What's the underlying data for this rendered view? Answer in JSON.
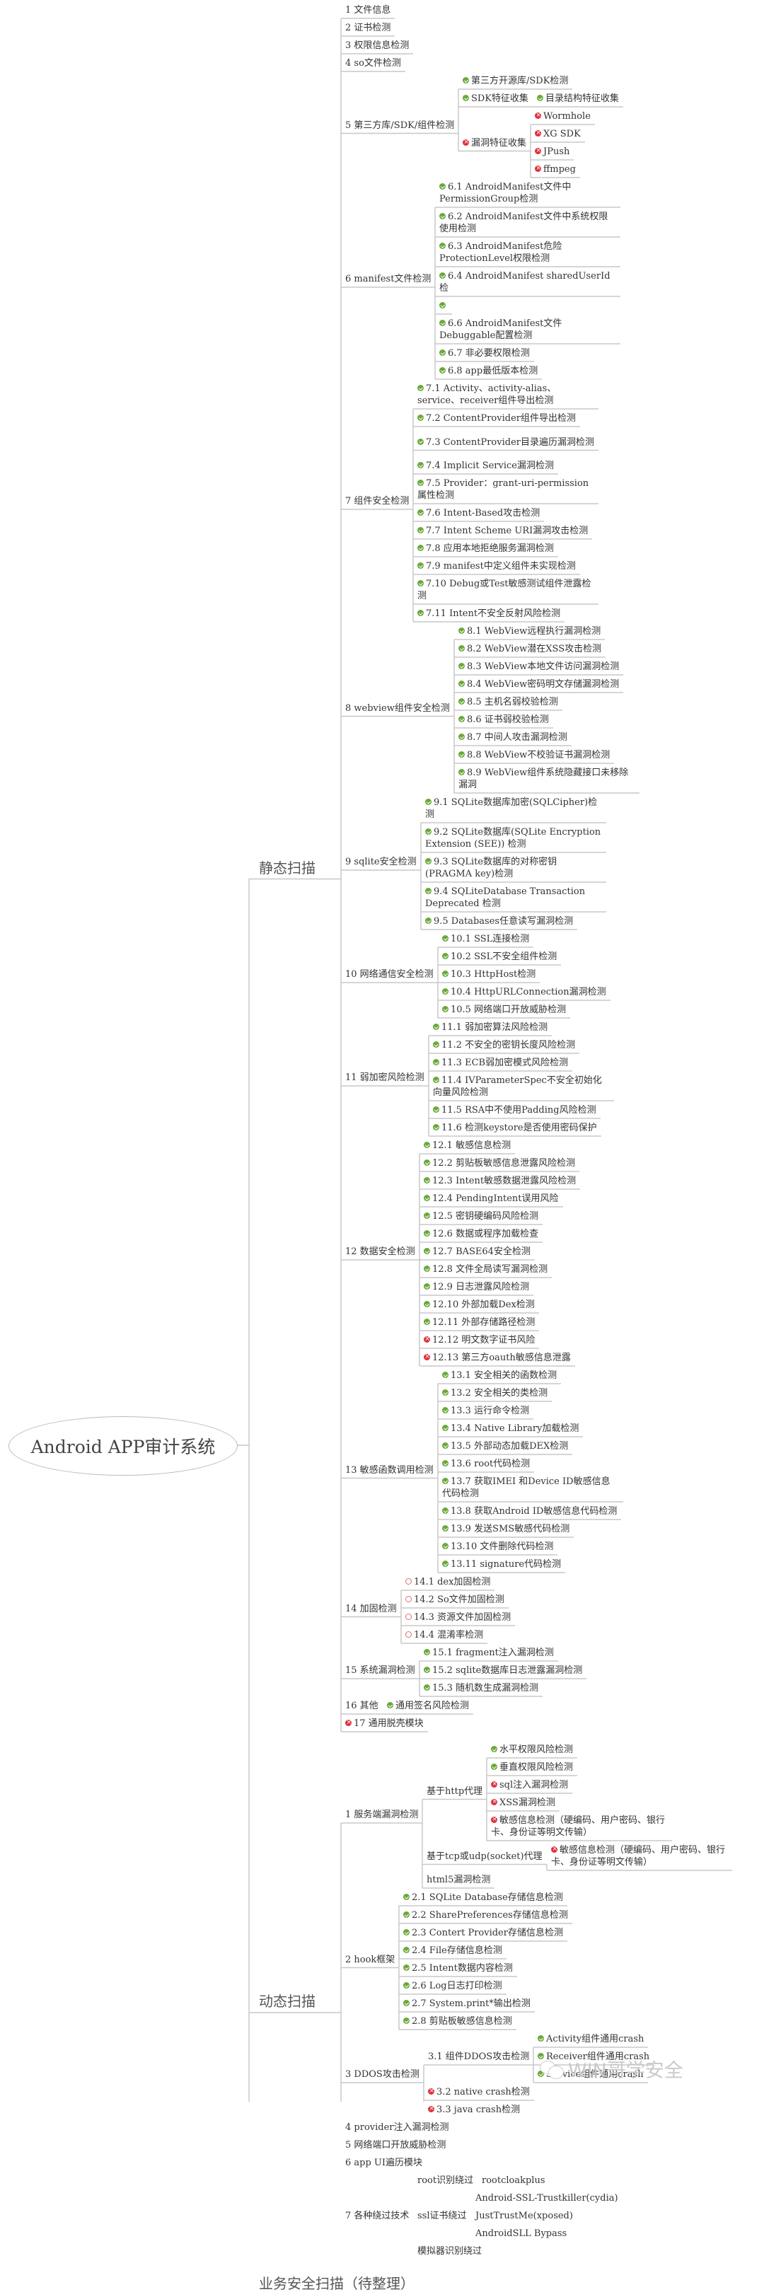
{
  "root": {
    "label": "Android APP审计系统"
  },
  "watermark": {
    "label": "WIN哥学安全",
    "icon": "wechat-icon"
  },
  "legend_colors": {
    "ok": "#6aa838",
    "bad": "#e0303c",
    "pending": "#e07070",
    "line": "#c8c8c8"
  },
  "branches": [
    {
      "label": "静态扫描",
      "children": [
        {
          "label": "1 文件信息"
        },
        {
          "label": "2 证书检测"
        },
        {
          "label": "3 权限信息检测"
        },
        {
          "label": "4 so文件检测"
        },
        {
          "label": "5 第三方库/SDK/组件检测",
          "children": [
            {
              "label": "第三方开源库/SDK检测",
              "status": "ok"
            },
            {
              "label": "SDK特征收集",
              "status": "ok",
              "children": [
                {
                  "label": "目录结构特征收集",
                  "status": "ok"
                }
              ]
            },
            {
              "label": "漏洞特征收集",
              "status": "bad",
              "children": [
                {
                  "label": "Wormhole",
                  "status": "bad"
                },
                {
                  "label": "XG SDK",
                  "status": "bad"
                },
                {
                  "label": "JPush",
                  "status": "bad"
                },
                {
                  "label": "ffmpeg",
                  "status": "bad"
                }
              ]
            }
          ]
        },
        {
          "label": "6 manifest文件检测",
          "children": [
            {
              "label": "6.1 AndroidManifest文件中PermissionGroup检测",
              "status": "ok"
            },
            {
              "label": "6.2 AndroidManifest文件中系统权限使用检测",
              "status": "ok"
            },
            {
              "label": "6.3 AndroidManifest危险ProtectionLevel权限检测",
              "status": "ok"
            },
            {
              "label": "6.4 AndroidManifest sharedUserId 检",
              "status": "ok"
            },
            {
              "label": "",
              "status": "ok"
            },
            {
              "label": "6.6 AndroidManifest文件Debuggable配置检测",
              "status": "ok"
            },
            {
              "label": "6.7 非必要权限检测",
              "status": "ok"
            },
            {
              "label": "6.8 app最低版本检测",
              "status": "ok"
            }
          ]
        },
        {
          "label": "7 组件安全检测",
          "children": [
            {
              "label": "7.1 Activity、activity-alias、service、receiver组件导出检测",
              "status": "ok"
            },
            {
              "label": "7.2 ContentProvider组件导出检测",
              "status": "ok"
            },
            {
              "label": "7.3 ContentProvider目录遍历漏洞检测",
              "status": "ok"
            },
            {
              "label": "7.4 Implicit Service漏洞检测",
              "status": "ok"
            },
            {
              "label": "7.5 Provider：grant-uri-permission属性检测",
              "status": "ok"
            },
            {
              "label": "7.6 Intent-Based攻击检测",
              "status": "ok"
            },
            {
              "label": "7.7 Intent Scheme URI漏洞攻击检测",
              "status": "ok"
            },
            {
              "label": "7.8 应用本地拒绝服务漏洞检测",
              "status": "ok"
            },
            {
              "label": "7.9 manifest中定义组件未实现检测",
              "status": "ok"
            },
            {
              "label": "7.10 Debug或Test敏感测试组件泄露检测",
              "status": "ok"
            },
            {
              "label": "7.11 Intent不安全反射风险检测",
              "status": "ok"
            }
          ]
        },
        {
          "label": "8 webview组件安全检测",
          "children": [
            {
              "label": "8.1 WebView远程执行漏洞检测",
              "status": "ok"
            },
            {
              "label": "8.2 WebView潜在XSS攻击检测",
              "status": "ok"
            },
            {
              "label": "8.3 WebView本地文件访问漏洞检测",
              "status": "ok"
            },
            {
              "label": "8.4 WebView密码明文存储漏洞检测",
              "status": "ok"
            },
            {
              "label": "8.5 主机名弱校验检测",
              "status": "ok"
            },
            {
              "label": "8.6 证书弱校验检测",
              "status": "ok"
            },
            {
              "label": "8.7 中间人攻击漏洞检测",
              "status": "ok"
            },
            {
              "label": "8.8 WebView不校验证书漏洞检测",
              "status": "ok"
            },
            {
              "label": "8.9 WebView组件系统隐藏接口未移除漏洞",
              "status": "ok"
            }
          ]
        },
        {
          "label": "9 sqlite安全检测",
          "children": [
            {
              "label": "9.1 SQLite数据库加密(SQLCipher)检测",
              "status": "ok"
            },
            {
              "label": "9.2 SQLite数据库(SQLite Encryption Extension (SEE)) 检测",
              "status": "ok"
            },
            {
              "label": "9.3 SQLite数据库的对称密钥(PRAGMA key)检测",
              "status": "ok"
            },
            {
              "label": "9.4 SQLiteDatabase Transaction Deprecated 检测",
              "status": "ok"
            },
            {
              "label": "9.5 Databases任意读写漏洞检测",
              "status": "ok"
            }
          ]
        },
        {
          "label": "10 网络通信安全检测",
          "children": [
            {
              "label": "10.1 SSL连接检测",
              "status": "ok"
            },
            {
              "label": "10.2 SSL不安全组件检测",
              "status": "ok"
            },
            {
              "label": "10.3 HttpHost检测",
              "status": "ok"
            },
            {
              "label": "10.4 HttpURLConnection漏洞检测",
              "status": "ok"
            },
            {
              "label": "10.5 网络端口开放威胁检测",
              "status": "ok"
            }
          ]
        },
        {
          "label": "11 弱加密风险检测",
          "children": [
            {
              "label": "11.1 弱加密算法风险检测",
              "status": "ok"
            },
            {
              "label": "11.2 不安全的密钥长度风险检测",
              "status": "ok"
            },
            {
              "label": "11.3 ECB弱加密模式风险检测",
              "status": "ok"
            },
            {
              "label": "11.4 IVParameterSpec不安全初始化向量风险检测",
              "status": "ok"
            },
            {
              "label": "11.5 RSA中不使用Padding风险检测",
              "status": "ok"
            },
            {
              "label": "11.6 检测keystore是否使用密码保护",
              "status": "ok"
            }
          ]
        },
        {
          "label": "12 数据安全检测",
          "children": [
            {
              "label": "12.1 敏感信息检测",
              "status": "ok"
            },
            {
              "label": "12.2 剪贴板敏感信息泄露风险检测",
              "status": "ok"
            },
            {
              "label": "12.3 Intent敏感数据泄露风险检测",
              "status": "ok"
            },
            {
              "label": "12.4 PendingIntent误用风险",
              "status": "ok"
            },
            {
              "label": "12.5 密钥硬编码风险检测",
              "status": "ok"
            },
            {
              "label": "12.6 数据或程序加载检查",
              "status": "ok"
            },
            {
              "label": "12.7 BASE64安全检测",
              "status": "ok"
            },
            {
              "label": "12.8 文件全局读写漏洞检测",
              "status": "ok"
            },
            {
              "label": "12.9 日志泄露风险检测",
              "status": "ok"
            },
            {
              "label": "12.10 外部加载Dex检测",
              "status": "ok"
            },
            {
              "label": "12.11 外部存储路径检测",
              "status": "ok"
            },
            {
              "label": "12.12 明文数字证书风险",
              "status": "bad"
            },
            {
              "label": "12.13 第三方oauth敏感信息泄露",
              "status": "bad"
            }
          ]
        },
        {
          "label": "13 敏感函数调用检测",
          "children": [
            {
              "label": "13.1 安全相关的函数检测",
              "status": "ok"
            },
            {
              "label": "13.2 安全相关的类检测",
              "status": "ok"
            },
            {
              "label": "13.3 运行命令检测",
              "status": "ok"
            },
            {
              "label": "13.4 Native Library加载检测",
              "status": "ok"
            },
            {
              "label": "13.5 外部动态加载DEX检测",
              "status": "ok"
            },
            {
              "label": "13.6 root代码检测",
              "status": "ok"
            },
            {
              "label": "13.7 获取IMEI 和Device ID敏感信息代码检测",
              "status": "ok"
            },
            {
              "label": "13.8 获取Android ID敏感信息代码检测",
              "status": "ok"
            },
            {
              "label": "13.9 发送SMS敏感代码检测",
              "status": "ok"
            },
            {
              "label": "13.10 文件删除代码检测",
              "status": "ok"
            },
            {
              "label": "13.11 signature代码检测",
              "status": "ok"
            }
          ]
        },
        {
          "label": "14 加固检测",
          "children": [
            {
              "label": "14.1 dex加固检测",
              "status": "pending"
            },
            {
              "label": "14.2 So文件加固检测",
              "status": "pending"
            },
            {
              "label": "14.3 资源文件加固检测",
              "status": "pending"
            },
            {
              "label": "14.4 混淆率检测",
              "status": "pending"
            }
          ]
        },
        {
          "label": "15 系统漏洞检测",
          "children": [
            {
              "label": "15.1 fragment注入漏洞检测",
              "status": "ok"
            },
            {
              "label": "15.2 sqlite数据库日志泄露漏洞检测",
              "status": "ok"
            },
            {
              "label": "15.3 随机数生成漏洞检测",
              "status": "ok"
            }
          ]
        },
        {
          "label": "16 其他",
          "children": [
            {
              "label": "通用签名风险检测",
              "status": "ok"
            }
          ]
        },
        {
          "label": "17 通用脱壳模块",
          "status": "bad"
        }
      ]
    },
    {
      "label": "动态扫描",
      "children": [
        {
          "label": "1 服务端漏洞检测",
          "children": [
            {
              "label": "基于http代理",
              "children": [
                {
                  "label": "水平权限风险检测",
                  "status": "ok"
                },
                {
                  "label": "垂直权限风险检测",
                  "status": "ok"
                },
                {
                  "label": "sql注入漏洞检测",
                  "status": "bad"
                },
                {
                  "label": "XSS漏洞检测",
                  "status": "bad"
                },
                {
                  "label": "敏感信息检测（硬编码、用户密码、银行卡、身份证等明文传输）",
                  "status": "bad"
                }
              ]
            },
            {
              "label": "基于tcp或udp(socket)代理",
              "children": [
                {
                  "label": "敏感信息检测（硬编码、用户密码、银行卡、身份证等明文传输）",
                  "status": "bad"
                }
              ]
            },
            {
              "label": "html5漏洞检测"
            }
          ]
        },
        {
          "label": "2 hook框架",
          "children": [
            {
              "label": "2.1 SQLite Database存储信息检测",
              "status": "ok"
            },
            {
              "label": "2.2 SharePreferences存储信息检测",
              "status": "ok"
            },
            {
              "label": "2.3 Contert Provider存储信息检测",
              "status": "ok"
            },
            {
              "label": "2.4 File存储信息检测",
              "status": "ok"
            },
            {
              "label": "2.5  Intent数据内容检测",
              "status": "ok"
            },
            {
              "label": "2.6 Log日志打印检测",
              "status": "ok"
            },
            {
              "label": "2.7 System.print*输出检测",
              "status": "ok"
            },
            {
              "label": "2.8 剪贴板敏感信息检测",
              "status": "ok"
            }
          ]
        },
        {
          "label": "3 DDOS攻击检测",
          "children": [
            {
              "label": "3.1 组件DDOS攻击检测",
              "children": [
                {
                  "label": "Activity组件通用crash",
                  "status": "ok"
                },
                {
                  "label": "Receiver组件通用crash",
                  "status": "ok"
                },
                {
                  "label": "Service组件通用crash",
                  "status": "ok"
                }
              ]
            },
            {
              "label": "3.2 native crash检测",
              "status": "bad"
            },
            {
              "label": "3.3 java crash检测",
              "status": "bad"
            }
          ]
        },
        {
          "label": "4 provider注入漏洞检测"
        },
        {
          "label": "5 网络端口开放威胁检测"
        },
        {
          "label": "6 app UI遍历模块"
        },
        {
          "label": "7 各种绕过技术",
          "children": [
            {
              "label": "root识别绕过",
              "children": [
                {
                  "label": "rootcloakplus"
                }
              ]
            },
            {
              "label": "ssl证书绕过",
              "children": [
                {
                  "label": "Android-SSL-Trustkiller(cydia)"
                },
                {
                  "label": "JustTrustMe(xposed)"
                },
                {
                  "label": "AndroidSLL Bypass"
                }
              ]
            },
            {
              "label": "模拟器识别绕过"
            }
          ]
        }
      ]
    },
    {
      "label": "业务安全扫描（待整理）"
    }
  ]
}
